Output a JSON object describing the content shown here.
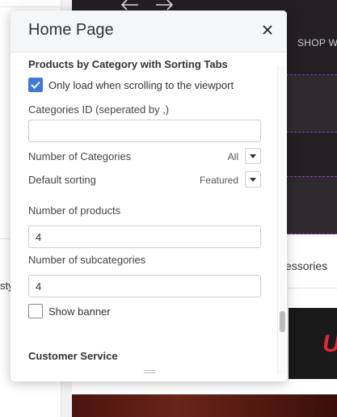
{
  "background": {
    "left_text": "sty",
    "shop_label": "SHOP WO",
    "accessories_label": "essories",
    "promo_letter": "U"
  },
  "panel": {
    "title": "Home Page",
    "close_icon": "close-icon",
    "section_title": "Products by Category with Sorting Tabs",
    "lazy_load": {
      "label": "Only load when scrolling to the viewport",
      "checked": true
    },
    "categories_id": {
      "label": "Categories ID (seperated by ,)",
      "value": ""
    },
    "number_of_categories": {
      "label": "Number of Categories",
      "value": "All"
    },
    "default_sorting": {
      "label": "Default sorting",
      "value": "Featured"
    },
    "number_of_products": {
      "label": "Number of products",
      "value": "4"
    },
    "number_of_subcategories": {
      "label": "Number of subcategories",
      "value": "4"
    },
    "show_banner": {
      "label": "Show banner",
      "checked": false
    },
    "next_section_title": "Customer Service"
  },
  "colors": {
    "accent": "#3f7ad8",
    "dark_header": "#231f23",
    "dashed_guide": "#8a3fd0",
    "promo_red": "#e0283a"
  }
}
